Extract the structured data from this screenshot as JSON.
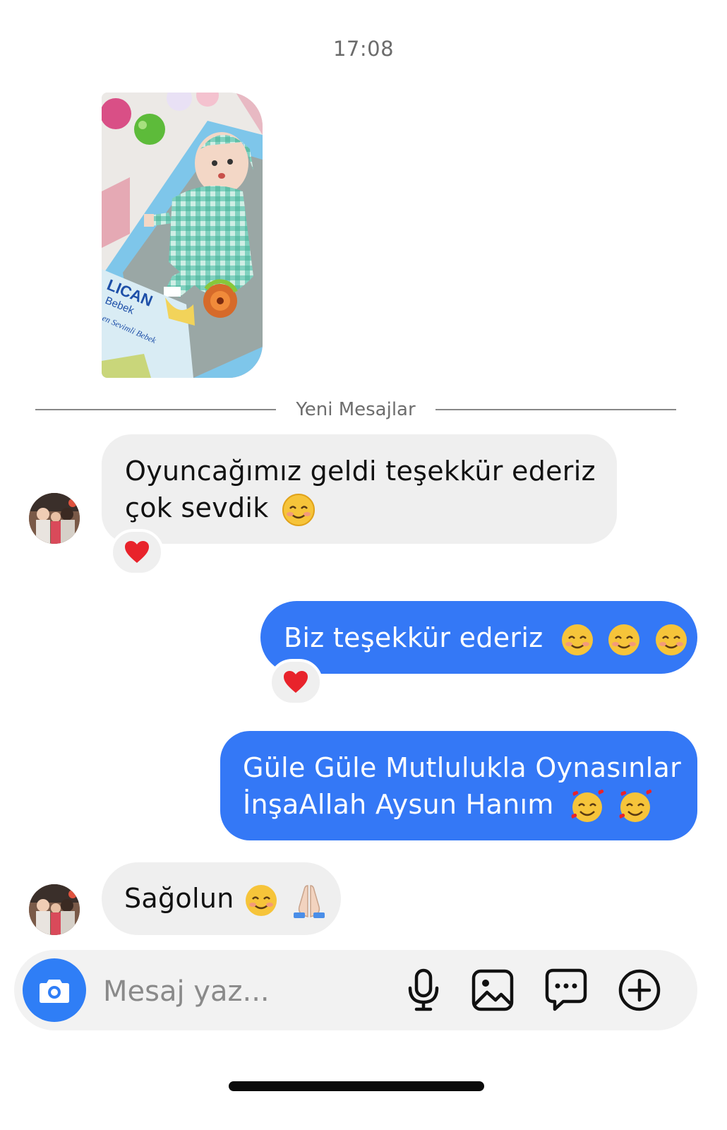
{
  "timestamp": "17:08",
  "shared_photo": {
    "box_text_line1": "LICAN",
    "box_text_line2": "Bebek",
    "box_text_line3": "en Sevimli Bebek"
  },
  "divider": {
    "label": "Yeni Mesajlar"
  },
  "messages": [
    {
      "from": "them",
      "text_line1": "Oyuncağımız geldi teşekkür ederiz",
      "text_line2": "çok sevdik",
      "reaction": "heart"
    },
    {
      "from": "me",
      "text_line1": "Biz teşekkür ederiz",
      "reaction": "heart"
    },
    {
      "from": "me",
      "text_line1": "Güle Güle Mutlulukla Oynasınlar",
      "text_line2": "İnşaAllah Aysun Hanım"
    },
    {
      "from": "them",
      "text_line1": "Sağolun"
    }
  ],
  "composer": {
    "placeholder": "Mesaj yaz...",
    "icons": [
      "camera-icon",
      "microphone-icon",
      "gallery-icon",
      "sticker-icon",
      "plus-icon"
    ]
  },
  "colors": {
    "outgoing": "#3478f6",
    "incoming": "#efefef",
    "camera_button": "#2f7ef6",
    "reaction_heart": "#e8232b"
  }
}
